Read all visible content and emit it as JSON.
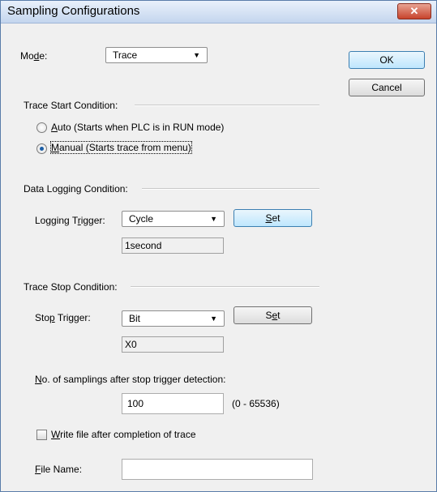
{
  "window": {
    "title": "Sampling Configurations",
    "close_glyph": "✕"
  },
  "mode": {
    "label_pre": "Mo",
    "label_ul": "d",
    "label_post": "e:",
    "value": "Trace"
  },
  "buttons": {
    "ok": "OK",
    "cancel": "Cancel"
  },
  "trace_start": {
    "header": "Trace Start Condition:",
    "auto_ul": "A",
    "auto_rest": "uto (Starts when PLC is in RUN mode)",
    "manual_ul": "M",
    "manual_rest": "anual (Starts trace from menu)",
    "selected": "manual"
  },
  "data_logging": {
    "header": "Data Logging Condition:",
    "trigger_label_pre": "Logging T",
    "trigger_label_ul": "r",
    "trigger_label_post": "igger:",
    "trigger_value": "Cycle",
    "set_ul": "S",
    "set_rest": "et",
    "cycle_value": "1second"
  },
  "trace_stop": {
    "header": "Trace Stop Condition:",
    "trigger_label_pre": "Sto",
    "trigger_label_ul": "p",
    "trigger_label_post": " Trigger:",
    "trigger_value": "Bit",
    "set_pre": "S",
    "set_ul": "e",
    "set_post": "t",
    "device_value": "X0",
    "samplings_ul": "N",
    "samplings_rest": "o. of samplings after stop trigger detection:",
    "samplings_value": "100",
    "samplings_range": "(0 - 65536)",
    "write_file_ul": "W",
    "write_file_rest": "rite file after completion of trace",
    "write_file_checked": false,
    "file_name_ul": "F",
    "file_name_rest": "ile Name:",
    "file_name_value": ""
  },
  "icons": {
    "dropdown": "▼"
  }
}
